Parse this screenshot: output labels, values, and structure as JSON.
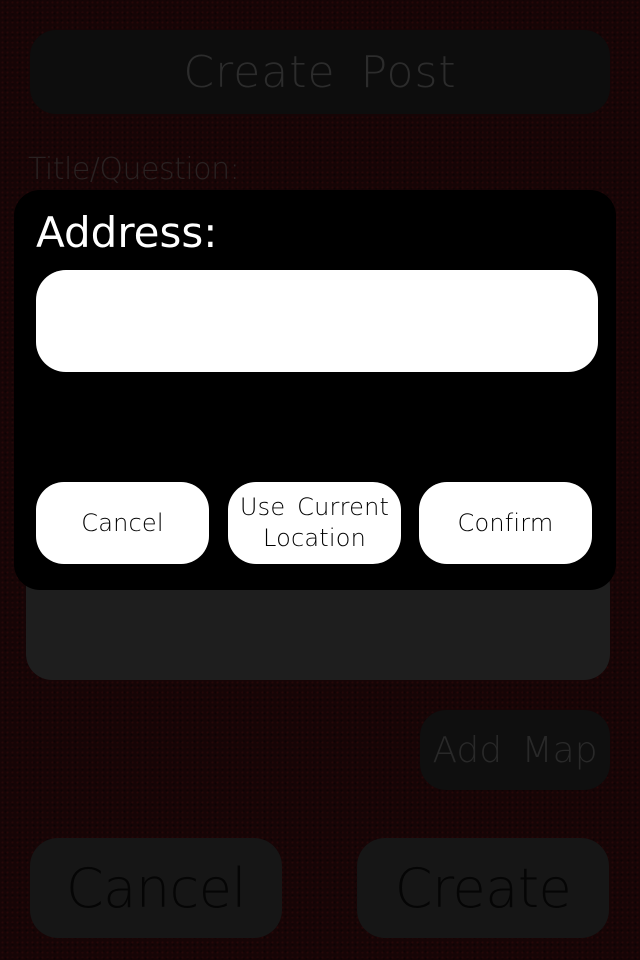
{
  "page": {
    "title": "Create Post",
    "title_field_label": "Title/Question:",
    "add_map_label": "Add Map",
    "cancel_label": "Cancel",
    "create_label": "Create"
  },
  "address_dialog": {
    "label": "Address:",
    "input_value": "",
    "cancel_label": "Cancel",
    "use_current_location_label": "Use Current\nLocation",
    "confirm_label": "Confirm"
  },
  "colors": {
    "background": "#160506",
    "dialog_background": "#000000",
    "dialog_button": "#ffffff",
    "dialog_text": "#ffffff"
  }
}
